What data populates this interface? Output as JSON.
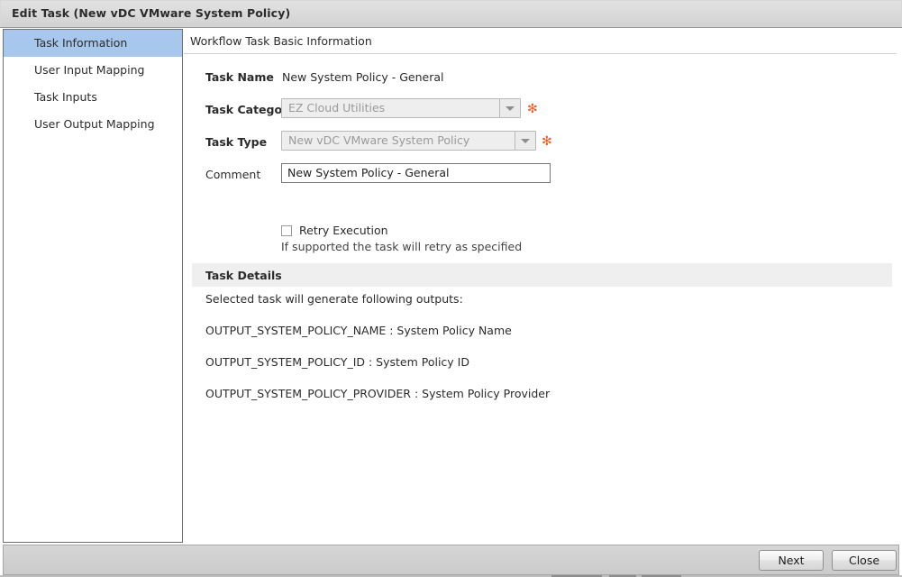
{
  "window": {
    "title": "Edit Task (New vDC VMware System Policy)"
  },
  "sidebar": {
    "items": [
      {
        "label": "Task Information",
        "selected": true
      },
      {
        "label": "User Input Mapping",
        "selected": false
      },
      {
        "label": "Task Inputs",
        "selected": false
      },
      {
        "label": "User Output Mapping",
        "selected": false
      }
    ]
  },
  "content": {
    "header": "Workflow Task Basic Information",
    "fields": {
      "task_name": {
        "label": "Task Name",
        "value": "New System Policy - General"
      },
      "task_category": {
        "label": "Task Category",
        "value": "EZ Cloud Utilities",
        "required_marker": "✻",
        "disabled": true
      },
      "task_type": {
        "label": "Task Type",
        "value": "New vDC VMware System Policy",
        "required_marker": "✻",
        "disabled": true
      },
      "comment": {
        "label": "Comment",
        "value": "New System Policy - General",
        "placeholder": ""
      },
      "retry_execution": {
        "label": "Retry Execution",
        "hint": "If supported the task will retry as specified",
        "checked": false
      }
    },
    "task_details": {
      "heading": "Task Details",
      "intro": "Selected task will generate following outputs:",
      "outputs": [
        "OUTPUT_SYSTEM_POLICY_NAME : System Policy Name",
        "OUTPUT_SYSTEM_POLICY_ID : System Policy ID",
        "OUTPUT_SYSTEM_POLICY_PROVIDER : System Policy Provider"
      ]
    }
  },
  "footer": {
    "next_label": "Next",
    "close_label": "Close"
  },
  "colors": {
    "titlebar": "#d8d8d8",
    "sidebar_selected": "#a8c7ec",
    "required_asterisk": "#ef5b25",
    "details_band": "#efefef",
    "footer": "#d2d2d2"
  }
}
